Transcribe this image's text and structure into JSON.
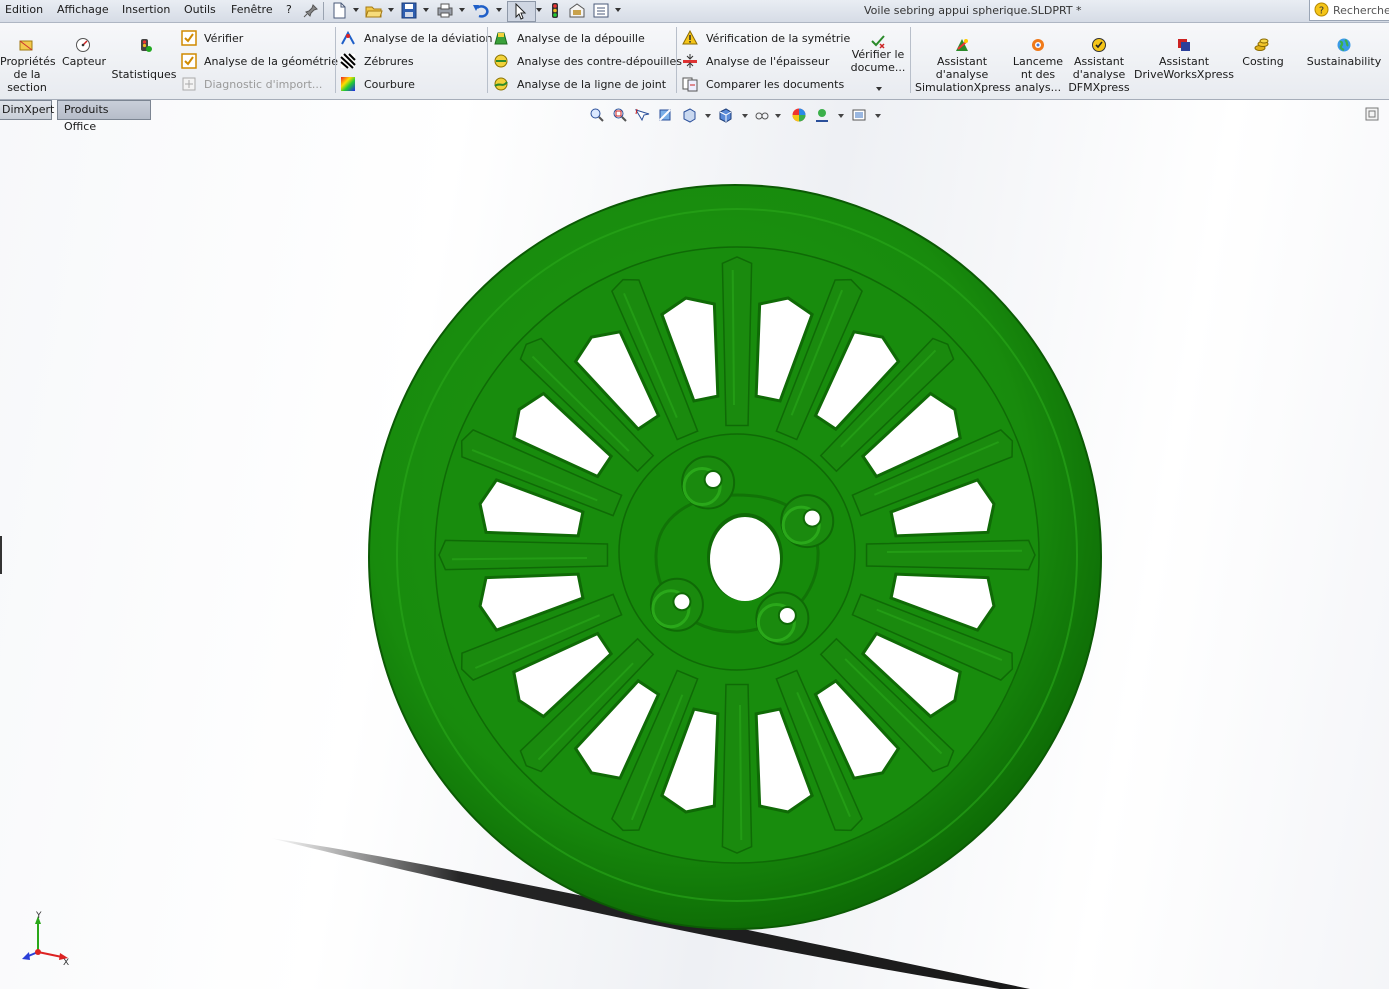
{
  "menu": {
    "items": [
      "Edition",
      "Affichage",
      "Insertion",
      "Outils",
      "Fenêtre",
      "?"
    ]
  },
  "document_title": "Voile sebring appui spherique.SLDPRT *",
  "search": {
    "placeholder": "Recherche"
  },
  "ribbon": {
    "section_properties": "Propriétés de la section",
    "sensor": "Capteur",
    "statistics": "Statistiques",
    "verify": "Vérifier",
    "geometry_analysis": "Analyse de la géométrie",
    "import_diagnostics": "Diagnostic d'import...",
    "deviation_analysis": "Analyse de la déviation",
    "zebra": "Zébrures",
    "curvature": "Courbure",
    "draft_analysis": "Analyse de la dépouille",
    "undercut_analysis": "Analyse des contre-dépouilles",
    "parting_line_analysis": "Analyse de la ligne de joint",
    "symmetry_check": "Vérification de la symétrie",
    "thickness_analysis": "Analyse de l'épaisseur",
    "compare_documents": "Comparer les documents",
    "check_docs": "Vérifier le docume...",
    "simulation_xpress": "Assistant d'analyse SimulationXpress",
    "launch_analysis": "Lanceme nt des analys...",
    "dfm_xpress": "Assistant d'analyse DFMXpress",
    "driveworks_xpress": "Assistant DriveWorksXpress",
    "costing": "Costing",
    "sustainability": "Sustainability"
  },
  "tabs": [
    "DimXpert",
    "Produits Office"
  ],
  "model": {
    "color": "#1a8a0e",
    "shade": "#0f6a06",
    "light": "#2aa81a"
  },
  "triad": {
    "x_label": "X",
    "y_label": "Y"
  }
}
